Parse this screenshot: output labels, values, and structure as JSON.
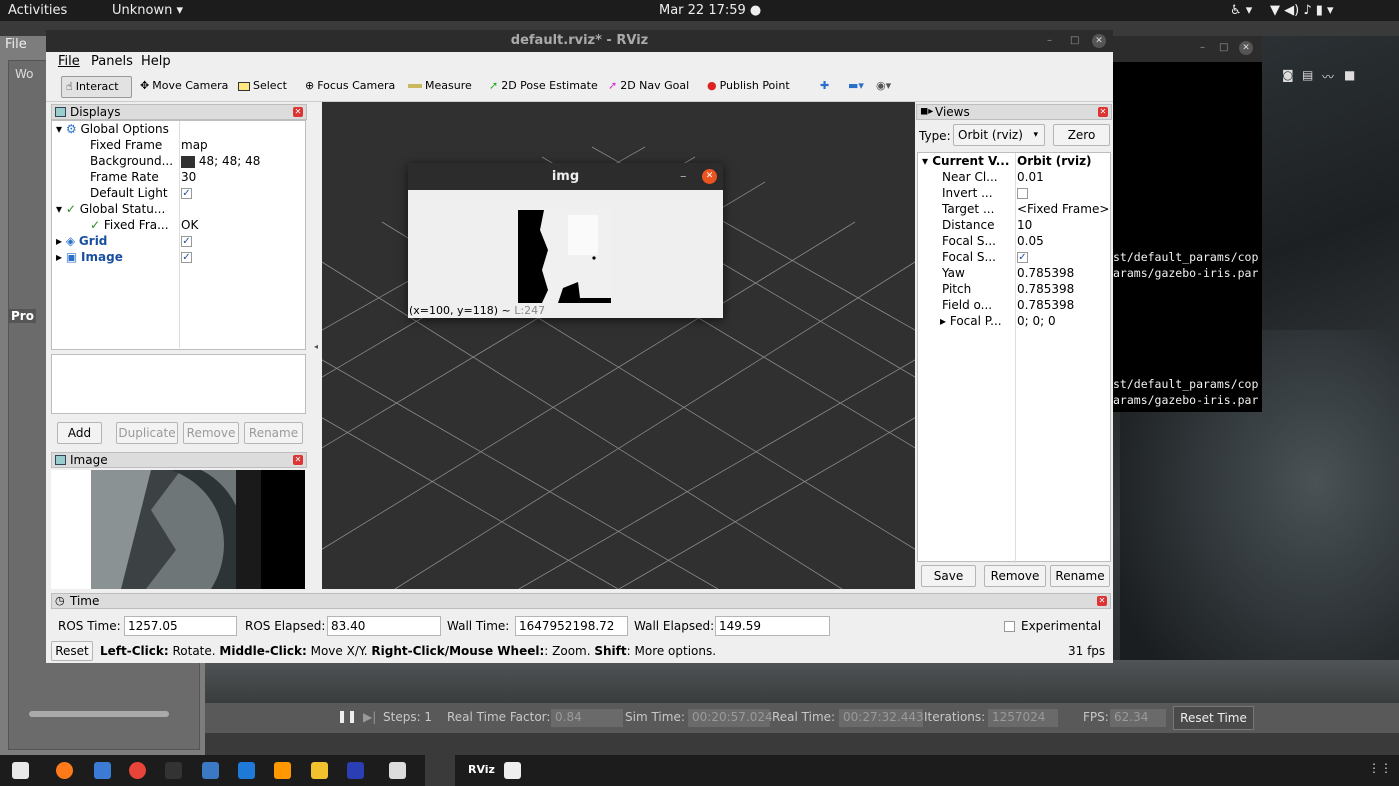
{
  "topbar": {
    "activities": "Activities",
    "app_menu": "Unknown ▾",
    "clock": "Mar 22  17:59 ●"
  },
  "background_app": {
    "file_menu": "File",
    "left_partial": [
      "Wo",
      "Pro"
    ]
  },
  "gazebo": {
    "pause": "❚❚",
    "steps_label": "Steps: 1",
    "real_time_factor_label": "Real Time Factor:",
    "real_time_factor": "0.84",
    "sim_time_label": "Sim Time:",
    "sim_time": "00:20:57.024",
    "real_time_label": "Real Time:",
    "real_time": "00:27:32.443",
    "iterations_label": "Iterations:",
    "iterations": "1257024",
    "fps_label": "FPS:",
    "fps": "62.34",
    "reset_time": "Reset Time"
  },
  "terminal": {
    "lines": [
      "st/default_params/cop",
      "arams/gazebo-iris.par",
      "st/default_params/cop",
      "arams/gazebo-iris.par"
    ]
  },
  "rviz": {
    "title": "default.rviz* - RViz",
    "menu": [
      "File",
      "Panels",
      "Help"
    ],
    "toolbar": {
      "interact": "Interact",
      "move_camera": "Move Camera",
      "select": "Select",
      "focus_camera": "Focus Camera",
      "measure": "Measure",
      "pose_estimate": "2D Pose Estimate",
      "nav_goal": "2D Nav Goal",
      "publish_point": "Publish Point"
    },
    "displays": {
      "title": "Displays",
      "global_options": "Global Options",
      "fixed_frame_label": "Fixed Frame",
      "fixed_frame": "map",
      "background_label": "Background...",
      "background": "48; 48; 48",
      "frame_rate_label": "Frame Rate",
      "frame_rate": "30",
      "default_light_label": "Default Light",
      "global_status": "Global Statu...",
      "fixed_frame_status_label": "Fixed Fra...",
      "fixed_frame_status": "OK",
      "grid": "Grid",
      "image": "Image",
      "buttons": {
        "add": "Add",
        "duplicate": "Duplicate",
        "remove": "Remove",
        "rename": "Rename"
      }
    },
    "image_panel": {
      "title": "Image"
    },
    "views": {
      "title": "Views",
      "type_label": "Type:",
      "type_value": "Orbit (rviz)",
      "zero": "Zero",
      "current_view_label": "Current V...",
      "current_view": "Orbit (rviz)",
      "rows": [
        {
          "label": "Near Cl...",
          "value": "0.01"
        },
        {
          "label": "Invert ...",
          "value": ""
        },
        {
          "label": "Target ...",
          "value": "<Fixed Frame>"
        },
        {
          "label": "Distance",
          "value": "10"
        },
        {
          "label": "Focal S...",
          "value": "0.05"
        },
        {
          "label": "Focal S...",
          "value": ""
        },
        {
          "label": "Yaw",
          "value": "0.785398"
        },
        {
          "label": "Pitch",
          "value": "0.785398"
        },
        {
          "label": "Field o...",
          "value": "0.785398"
        },
        {
          "label": "Focal P...",
          "value": "0; 0; 0"
        }
      ],
      "buttons": {
        "save": "Save",
        "remove": "Remove",
        "rename": "Rename"
      }
    },
    "time": {
      "title": "Time",
      "ros_time_label": "ROS Time:",
      "ros_time": "1257.05",
      "ros_elapsed_label": "ROS Elapsed:",
      "ros_elapsed": "83.40",
      "wall_time_label": "Wall Time:",
      "wall_time": "1647952198.72",
      "wall_elapsed_label": "Wall Elapsed:",
      "wall_elapsed": "149.59",
      "experimental": "Experimental",
      "reset": "Reset",
      "hint_b1": "Left-Click:",
      "hint_t1": " Rotate. ",
      "hint_b2": "Middle-Click:",
      "hint_t2": " Move X/Y. ",
      "hint_b3": "Right-Click/Mouse Wheel:",
      "hint_t3": ": Zoom. ",
      "hint_b4": "Shift",
      "hint_t4": ": More options.",
      "fps": "31 fps"
    }
  },
  "img_window": {
    "title": "img",
    "status_coords": "(x=100, y=118) ~",
    "status_value": "L:247"
  },
  "dock": {
    "rviz_label": "RViz"
  }
}
